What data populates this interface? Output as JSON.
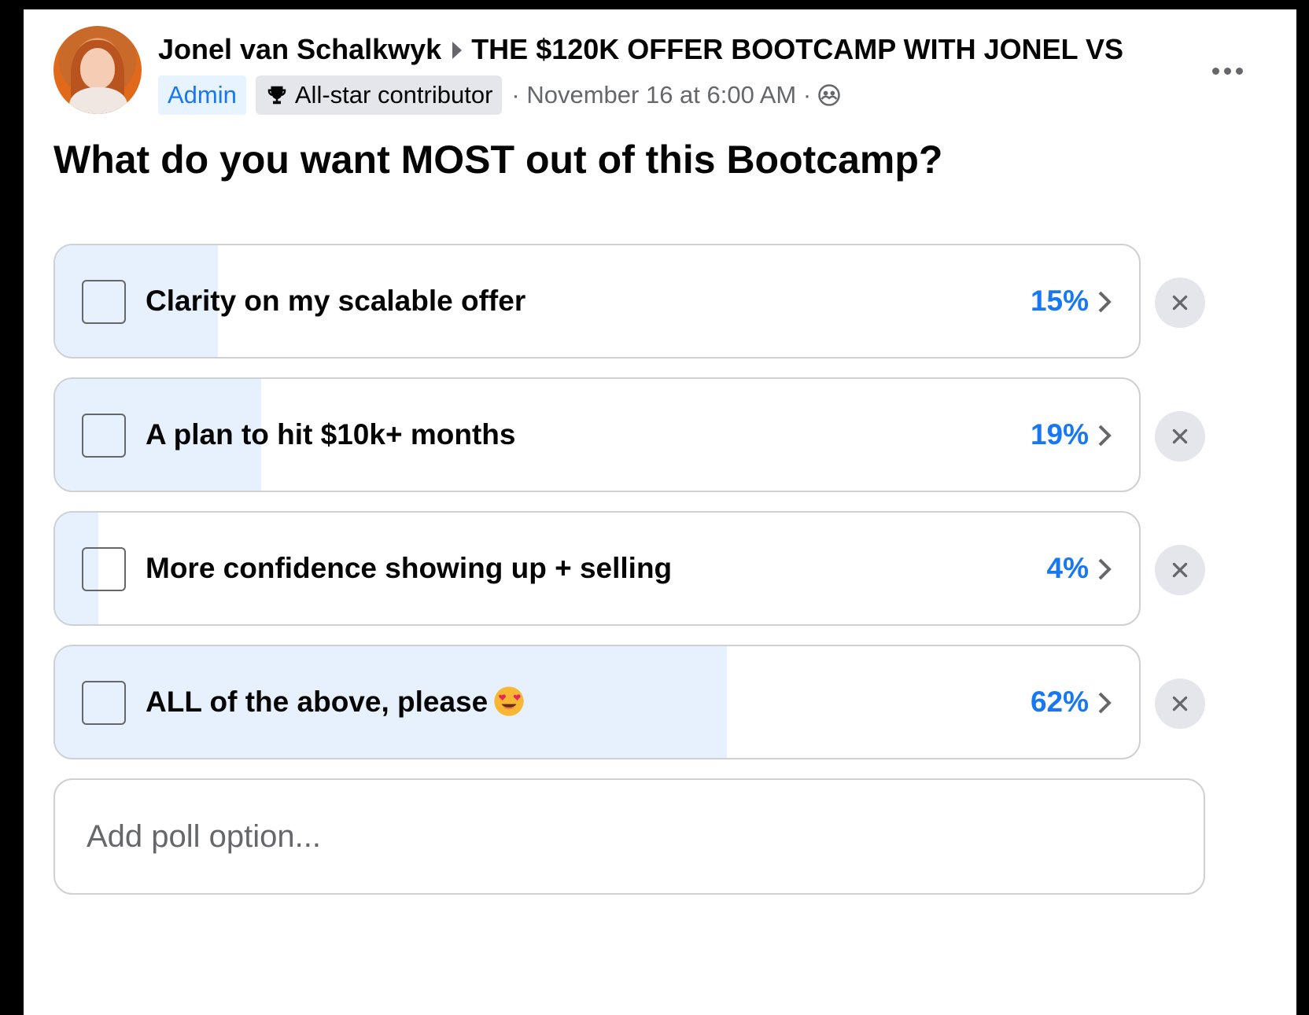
{
  "post": {
    "author": "Jonel van Schalkwyk",
    "group": "THE $120K OFFER BOOTCAMP WITH JONEL VS",
    "badges": {
      "admin": "Admin",
      "contributor": "All-star contributor"
    },
    "timestamp": "· November 16 at 6:00 AM ·",
    "audience_icon": "group-privacy-icon",
    "question": "What do you want MOST out of this Bootcamp?"
  },
  "poll": {
    "options": [
      {
        "label": "Clarity on my scalable offer",
        "percent_label": "15%",
        "percent": 15
      },
      {
        "label": "A plan to hit $10k+ months",
        "percent_label": "19%",
        "percent": 19
      },
      {
        "label": "More confidence showing up + selling",
        "percent_label": "4%",
        "percent": 4
      },
      {
        "label": "ALL of the above, please",
        "percent_label": "62%",
        "percent": 62,
        "emoji": "heart-eyes"
      }
    ],
    "add_placeholder": "Add poll option..."
  },
  "colors": {
    "accent": "#1877f2",
    "bar_fill": "#e7f0fd",
    "secondary_text": "#65676b"
  }
}
